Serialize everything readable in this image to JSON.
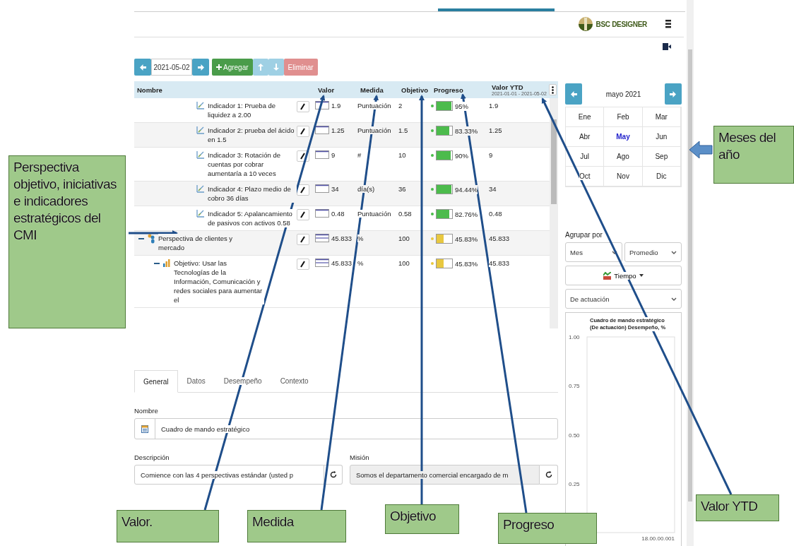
{
  "header": {
    "logo_text": "BSC DESIGNER"
  },
  "toolbar": {
    "date": "2021-05-02",
    "add_label": "Agregar",
    "delete_label": "Eliminar"
  },
  "table": {
    "columns": [
      "Nombre",
      "Valor",
      "Medida",
      "Objetivo",
      "Progreso",
      "Valor YTD"
    ],
    "ytd_range": "2021-01-01 - 2021-05-02",
    "rows": [
      {
        "kind": "indicator",
        "name": "Indicador 1: Prueba de liquidez a 2.00",
        "value": "1.9",
        "measure": "Puntuación",
        "target": "2",
        "color": "#4cbb4c",
        "level": 0.95,
        "progress": "95%",
        "ytd": "1.9"
      },
      {
        "kind": "indicator",
        "name": "Indicador 2: prueba del ácido en 1.5",
        "value": "1.25",
        "measure": "Puntuación",
        "target": "1.5",
        "color": "#4cbb4c",
        "level": 0.8333,
        "progress": "83.33%",
        "ytd": "1.25"
      },
      {
        "kind": "indicator",
        "name": "Indicador 3: Rotación de cuentas por cobrar aumentaría a 10 veces",
        "value": "9",
        "measure": "#",
        "target": "10",
        "color": "#4cbb4c",
        "level": 0.9,
        "progress": "90%",
        "ytd": "9"
      },
      {
        "kind": "indicator",
        "name": "Indicador 4: Plazo medio de cobro 36 días",
        "value": "34",
        "measure": "día(s)",
        "target": "36",
        "color": "#4cbb4c",
        "level": 0.9444,
        "progress": "94.44%",
        "ytd": "34"
      },
      {
        "kind": "indicator",
        "name": "Indicador 5: Apalancamiento de pasivos con activos 0.58",
        "value": "0.48",
        "measure": "Puntuación",
        "target": "0.58",
        "color": "#4cbb4c",
        "level": 0.8276,
        "progress": "82.76%",
        "ytd": "0.48"
      },
      {
        "kind": "perspective",
        "name": "Perspectiva de clientes y mercado",
        "value": "45.833",
        "measure": "%",
        "target": "100",
        "color": "#e8c840",
        "level": 0.4583,
        "progress": "45.83%",
        "ytd": "45.833",
        "expanded": true,
        "children": [
          {
            "kind": "objective",
            "name": "Objetivo: Usar las Tecnologías de la Información, Comunicación y redes sociales para aumentar el",
            "value": "45.833",
            "measure": "%",
            "target": "100",
            "color": "#e8c840",
            "level": 0.4583,
            "progress": "45.83%",
            "ytd": "45.833",
            "expanded": true
          }
        ]
      }
    ]
  },
  "tabs": [
    {
      "label": "General",
      "selected": true
    },
    {
      "label": "Datos",
      "selected": false
    },
    {
      "label": "Desempeño",
      "selected": false
    },
    {
      "label": "Contexto",
      "selected": false
    }
  ],
  "form": {
    "name_label": "Nombre",
    "name_value": "Cuadro de mando estratégico",
    "description_label": "Descripción",
    "description_value": "Comience con las 4 perspectivas estándar (usted p",
    "mission_label": "Misión",
    "mission_value": "Somos el departamento comercial encargado de m"
  },
  "calendar": {
    "title": "mayo 2021",
    "months": [
      {
        "label": "Ene",
        "selected": false
      },
      {
        "label": "Feb",
        "selected": false
      },
      {
        "label": "Mar",
        "selected": false
      },
      {
        "label": "Abr",
        "selected": false
      },
      {
        "label": "May",
        "selected": true
      },
      {
        "label": "Jun",
        "selected": false
      },
      {
        "label": "Jul",
        "selected": false
      },
      {
        "label": "Ago",
        "selected": false
      },
      {
        "label": "Sep",
        "selected": false
      },
      {
        "label": "Oct",
        "selected": false
      },
      {
        "label": "Nov",
        "selected": false
      },
      {
        "label": "Dic",
        "selected": false
      }
    ]
  },
  "group_by": {
    "label": "Agrupar por",
    "period": "Mes",
    "aggregate": "Promedio",
    "view_button": "Tiempo",
    "indicator_type": "De actuación"
  },
  "chart": {
    "title": "Cuadro de mando estratégico (De actuación) Desempeño, %",
    "y_axis_labels": [
      "1.00",
      "0.75",
      "0.50",
      "0.25"
    ],
    "x_axis_end_label": "18.00.00.001"
  },
  "callouts": [
    {
      "text": "Perspectiva objetivo, iniciativas e indicadores estratégicos del CMI"
    },
    {
      "text": "Meses del año"
    },
    {
      "text": "Valor."
    },
    {
      "text": "Medida"
    },
    {
      "text": "Objetivo"
    },
    {
      "text": "Progreso"
    },
    {
      "text": "Valor YTD"
    }
  ]
}
